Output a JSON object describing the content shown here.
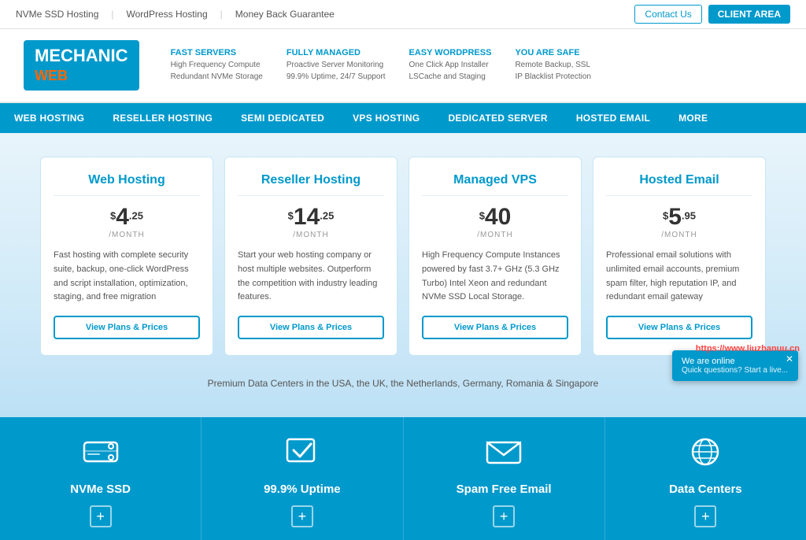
{
  "topbar": {
    "links": [
      "NVMe SSD Hosting",
      "WordPress Hosting",
      "Money Back Guarantee"
    ],
    "contact_label": "Contact Us",
    "client_label": "CLIENT AREA"
  },
  "header": {
    "logo_line1": "MECHANIC",
    "logo_line2": "web",
    "features": [
      {
        "title": "FAST SERVERS",
        "lines": [
          "High Frequency Compute",
          "Redundant NVMe Storage"
        ]
      },
      {
        "title": "FULLY MANAGED",
        "lines": [
          "Proactive Server Monitoring",
          "99.9% Uptime, 24/7 Support"
        ]
      },
      {
        "title": "EASY WORDPRESS",
        "lines": [
          "One Click App Installer",
          "LSCache and Staging"
        ]
      },
      {
        "title": "YOU ARE SAFE",
        "lines": [
          "Remote Backup, SSL",
          "IP Blacklist Protection"
        ]
      }
    ]
  },
  "nav": {
    "items": [
      "WEB HOSTING",
      "RESELLER HOSTING",
      "SEMI DEDICATED",
      "VPS HOSTING",
      "DEDICATED SERVER",
      "HOSTED EMAIL",
      "MORE"
    ]
  },
  "pricing": {
    "cards": [
      {
        "title": "Web Hosting",
        "dollar": "$",
        "amount": "4",
        "cents": ".25",
        "month": "/MONTH",
        "description": "Fast hosting with complete security suite, backup, one-click WordPress and script installation, optimization, staging, and free migration",
        "button": "View Plans & Prices"
      },
      {
        "title": "Reseller Hosting",
        "dollar": "$",
        "amount": "14",
        "cents": ".25",
        "month": "/MONTH",
        "description": "Start your web hosting company or host multiple websites. Outperform the competition with industry leading features.",
        "button": "View Plans & Prices"
      },
      {
        "title": "Managed VPS",
        "dollar": "$",
        "amount": "40",
        "cents": "",
        "month": "/MONTH",
        "description": "High Frequency Compute Instances powered by fast 3.7+ GHz (5.3 GHz Turbo) Intel Xeon and redundant NVMe SSD Local Storage.",
        "button": "View Plans & Prices"
      },
      {
        "title": "Hosted Email",
        "dollar": "$",
        "amount": "5",
        "cents": ".95",
        "month": "/MONTH",
        "description": "Professional email solutions with unlimited email accounts, premium spam filter, high reputation IP, and redundant email gateway",
        "button": "View Plans & Prices"
      }
    ]
  },
  "datacenter_note": "Premium Data Centers in the USA, the UK, the Netherlands, Germany, Romania & Singapore",
  "features_section": {
    "items": [
      {
        "icon": "hdd-icon",
        "label": "NVMe SSD",
        "plus": "+"
      },
      {
        "icon": "checkmark-icon",
        "label": "99.9% Uptime",
        "plus": "+"
      },
      {
        "icon": "email-icon",
        "label": "Spam Free Email",
        "plus": "+"
      },
      {
        "icon": "globe-icon",
        "label": "Data Centers",
        "plus": "+"
      }
    ]
  },
  "chat": {
    "online_label": "We are online",
    "prompt": "Quick questions? Start a live..."
  },
  "watermark": "https://www.liuzhanuu.cn"
}
